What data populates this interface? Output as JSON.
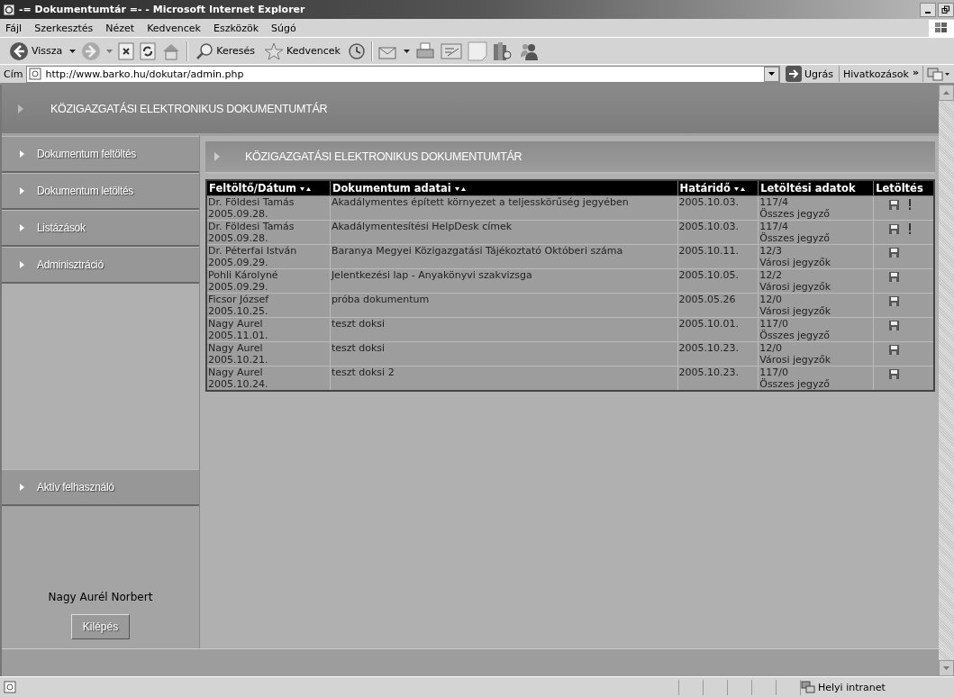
{
  "window": {
    "title": "-= Dokumentumtár =- - Microsoft Internet Explorer"
  },
  "menu": [
    "Fájl",
    "Szerkesztés",
    "Nézet",
    "Kedvencek",
    "Eszközök",
    "Súgó"
  ],
  "toolbar": {
    "back": "Vissza",
    "search": "Keresés",
    "favorites": "Kedvencek"
  },
  "address": {
    "label": "Cím",
    "url": "http://www.barko.hu/dokutar/admin.php",
    "go": "Ugrás",
    "links": "Hivatkozások",
    "more": "»"
  },
  "page_header": "KÖZIGAZGATÁSI ELEKTRONIKUS DOKUMENTUMTÁR",
  "sidebar": {
    "items": [
      "Dokumentum feltöltés",
      "Dokumentum letöltés",
      "Listázások",
      "Adminisztráció"
    ],
    "user_section": "Aktív felhasználó",
    "user_name": "Nagy Aurél Norbert",
    "logout": "Kilépés"
  },
  "content_header": "KÖZIGAZGATÁSI ELEKTRONIKUS DOKUMENTUMTÁR",
  "table": {
    "columns": [
      {
        "label": "Feltöltő/Dátum",
        "sortable": true
      },
      {
        "label": "Dokumentum adatai",
        "sortable": true
      },
      {
        "label": "Határidő",
        "sortable": true
      },
      {
        "label": "Letöltési adatok",
        "sortable": false
      },
      {
        "label": "Letöltés",
        "sortable": false
      }
    ],
    "rows": [
      {
        "uploader": "Dr. Földesi Tamás",
        "date": "2005.09.28.",
        "document": "Akadálymentes épített környezet a teljesskörűség jegyében",
        "deadline": "2005.10.03.",
        "count": "117/4",
        "audience": "Összes jegyző",
        "urgent": true
      },
      {
        "uploader": "Dr. Földesi Tamás",
        "date": "2005.09.28.",
        "document": "Akadálymentesítési HelpDesk címek",
        "deadline": "2005.10.03.",
        "count": "117/4",
        "audience": "Összes jegyző",
        "urgent": true
      },
      {
        "uploader": "Dr. Péterfai István",
        "date": "2005.09.29.",
        "document": "Baranya Megyei Közigazgatási Tájékoztató Októberi száma",
        "deadline": "2005.10.11.",
        "count": "12/3",
        "audience": "Városi jegyzők",
        "urgent": false
      },
      {
        "uploader": "Pohli Károlyné",
        "date": "2005.09.29.",
        "document": "Jelentkezési lap - Anyakönyvi szakvizsga",
        "deadline": "2005.10.05.",
        "count": "12/2",
        "audience": "Városi jegyzők",
        "urgent": false
      },
      {
        "uploader": "Ficsor József",
        "date": "2005.10.25.",
        "document": "próba dokumentum",
        "deadline": "2005.05.26",
        "count": "12/0",
        "audience": "Városi jegyzők",
        "urgent": false
      },
      {
        "uploader": "Nagy Aurel",
        "date": "2005.11.01.",
        "document": "teszt doksi",
        "deadline": "2005.10.01.",
        "count": "117/0",
        "audience": "Összes jegyző",
        "urgent": false
      },
      {
        "uploader": "Nagy Aurel",
        "date": "2005.10.21.",
        "document": "teszt doksi",
        "deadline": "2005.10.23.",
        "count": "12/0",
        "audience": "Városi jegyzők",
        "urgent": false
      },
      {
        "uploader": "Nagy Aurel",
        "date": "2005.10.24.",
        "document": "teszt doksi 2",
        "deadline": "2005.10.23.",
        "count": "117/0",
        "audience": "Összes jegyző",
        "urgent": false
      }
    ]
  },
  "status_bar": {
    "zone": "Helyi intranet"
  }
}
